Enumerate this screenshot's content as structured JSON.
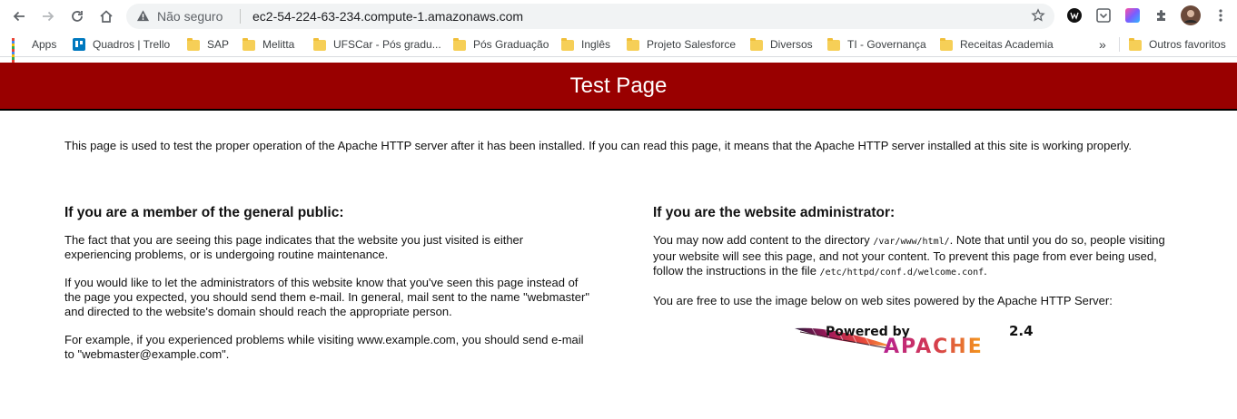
{
  "browser": {
    "security_label": "Não seguro",
    "url": "ec2-54-224-63-234.compute-1.amazonaws.com"
  },
  "bookmarks": {
    "items": [
      {
        "label": "Apps",
        "icon": "apps-icon"
      },
      {
        "label": "Quadros | Trello",
        "icon": "trello-icon"
      },
      {
        "label": "SAP",
        "icon": "folder-icon"
      },
      {
        "label": "Melitta",
        "icon": "folder-icon"
      },
      {
        "label": "UFSCar - Pós gradu...",
        "icon": "folder-icon"
      },
      {
        "label": "Pós Graduação",
        "icon": "folder-icon"
      },
      {
        "label": "Inglês",
        "icon": "folder-icon"
      },
      {
        "label": "Projeto Salesforce",
        "icon": "folder-icon"
      },
      {
        "label": "Diversos",
        "icon": "folder-icon"
      },
      {
        "label": "TI - Governança",
        "icon": "folder-icon"
      },
      {
        "label": "Receitas Academia",
        "icon": "folder-icon"
      }
    ],
    "overflow": "»",
    "other": "Outros favoritos"
  },
  "page": {
    "title": "Test Page",
    "intro": "This page is used to test the proper operation of the Apache HTTP server after it has been installed. If you can read this page, it means that the Apache HTTP server installed at this site is working properly.",
    "public": {
      "heading": "If you are a member of the general public:",
      "p1": "The fact that you are seeing this page indicates that the website you just visited is either experiencing problems, or is undergoing routine maintenance.",
      "p2": "If you would like to let the administrators of this website know that you've seen this page instead of the page you expected, you should send them e-mail. In general, mail sent to the name \"webmaster\" and directed to the website's domain should reach the appropriate person.",
      "p3": "For example, if you experienced problems while visiting www.example.com, you should send e-mail to \"webmaster@example.com\"."
    },
    "admin": {
      "heading": "If you are the website administrator:",
      "p1_a": "You may now add content to the directory ",
      "p1_dir": "/var/www/html/",
      "p1_b": ". Note that until you do so, people visiting your website will see this page, and not your content. To prevent this page from ever being used, follow the instructions in the file ",
      "p1_file": "/etc/httpd/conf.d/welcome.conf",
      "p1_c": ".",
      "p2": "You are free to use the image below on web sites powered by the Apache HTTP Server:"
    },
    "powered_by": {
      "line1": "Powered by",
      "version": "2.4",
      "name": "APACHE"
    }
  },
  "colors": {
    "banner": "#990000",
    "folder": "#f6cf57"
  }
}
